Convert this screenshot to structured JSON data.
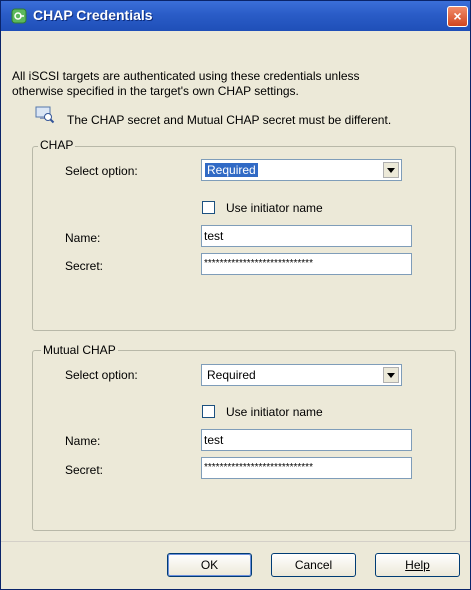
{
  "window": {
    "title": "CHAP Credentials",
    "close_glyph": "×"
  },
  "intro": {
    "line1": "All iSCSI targets are authenticated using these credentials unless",
    "line2": "otherwise specified in the target's own CHAP settings.",
    "note": "The CHAP secret and Mutual CHAP secret must be different.",
    "note_icon": "info-monitor-icon"
  },
  "chap": {
    "legend": "CHAP",
    "select_label": "Select option:",
    "select_value": "Required",
    "use_initiator_label": "Use initiator name",
    "use_initiator_checked": false,
    "name_label": "Name:",
    "name_value": "test",
    "secret_label": "Secret:",
    "secret_value": "****************************"
  },
  "mutual_chap": {
    "legend": "Mutual CHAP",
    "select_label": "Select option:",
    "select_value": "Required",
    "use_initiator_label": "Use initiator name",
    "use_initiator_checked": false,
    "name_label": "Name:",
    "name_value": "test",
    "secret_label": "Secret:",
    "secret_value": "****************************"
  },
  "buttons": {
    "ok": "OK",
    "cancel": "Cancel",
    "help": "Help"
  },
  "colors": {
    "title_bar": "#2a5cc7",
    "dialog_bg": "#ece9d8",
    "selection": "#316ac5",
    "close_button": "#d0451f"
  }
}
